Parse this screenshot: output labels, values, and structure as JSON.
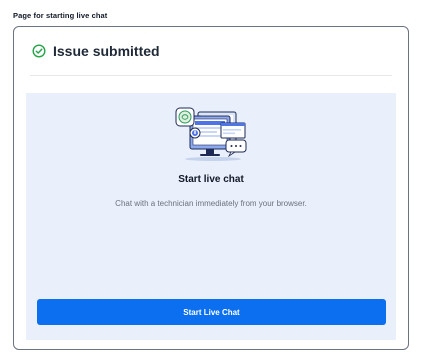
{
  "page": {
    "caption": "Page for starting live chat"
  },
  "header": {
    "icon": "check-circle-icon",
    "title": "Issue submitted",
    "status_color": "#22a447"
  },
  "panel": {
    "illustration": "live-chat-illustration",
    "title": "Start live chat",
    "description": "Chat with a technician immediately from your browser.",
    "background": "#e9f0fb"
  },
  "actions": {
    "start_label": "Start Live Chat",
    "button_color": "#0b6ff0"
  }
}
